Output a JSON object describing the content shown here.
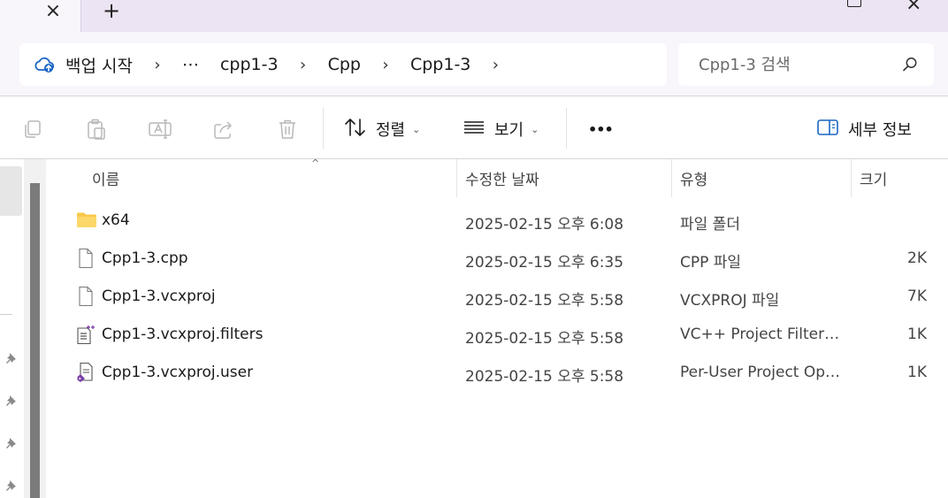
{
  "tabs": {
    "close_glyph": "×",
    "new_tab_glyph": "+"
  },
  "window": {
    "close_glyph": "×"
  },
  "breadcrumb": {
    "items": [
      "백업 시작",
      "⋯",
      "cpp1-3",
      "Cpp",
      "Cpp1-3"
    ],
    "separator": "›"
  },
  "search": {
    "placeholder": "Cpp1-3 검색"
  },
  "toolbar": {
    "sort_label": "정렬",
    "view_label": "보기",
    "more_label": "•••",
    "details_label": "세부 정보"
  },
  "columns": {
    "name": "이름",
    "modified": "수정한 날짜",
    "type": "유형",
    "size": "크기"
  },
  "files": [
    {
      "name": "x64",
      "date": "2025-02-15 오후 6:08",
      "type": "파일 폴더",
      "size": "",
      "icon": "folder-icon"
    },
    {
      "name": "Cpp1-3.cpp",
      "date": "2025-02-15 오후 6:35",
      "type": "CPP 파일",
      "size": "2K",
      "icon": "file-icon"
    },
    {
      "name": "Cpp1-3.vcxproj",
      "date": "2025-02-15 오후 5:58",
      "type": "VCXPROJ 파일",
      "size": "7K",
      "icon": "file-icon"
    },
    {
      "name": "Cpp1-3.vcxproj.filters",
      "date": "2025-02-15 오후 5:58",
      "type": "VC++ Project Filters ...",
      "size": "1K",
      "icon": "filters-file-icon"
    },
    {
      "name": "Cpp1-3.vcxproj.user",
      "date": "2025-02-15 오후 5:58",
      "type": "Per-User Project Opt...",
      "size": "1K",
      "icon": "vs-user-file-icon"
    }
  ],
  "colors": {
    "tabstrip": "#ece4f3",
    "nav_background": "#f8f5fb",
    "folder": "#f8c84a",
    "vs_purple": "#7a3ea8"
  }
}
